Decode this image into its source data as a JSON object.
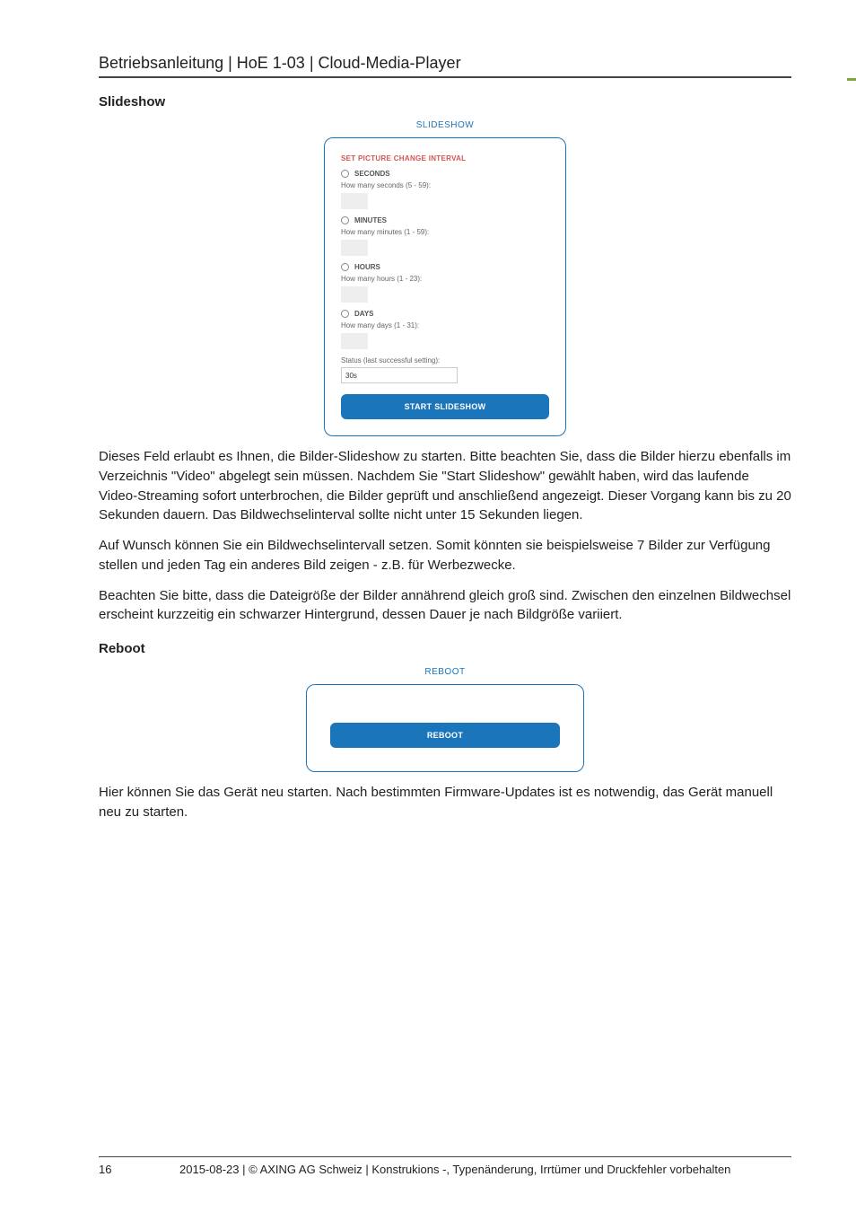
{
  "header": {
    "title": "Betriebsanleitung | HoE 1-03 | Cloud-Media-Player"
  },
  "sections": {
    "slideshow": {
      "heading": "Slideshow",
      "card": {
        "title": "SLIDESHOW",
        "groupTitle": "SET PICTURE CHANGE INTERVAL",
        "seconds": {
          "radio": "SECONDS",
          "hint": "How many seconds (5 - 59):"
        },
        "minutes": {
          "radio": "MINUTES",
          "hint": "How many minutes (1 - 59):"
        },
        "hours": {
          "radio": "HOURS",
          "hint": "How many hours (1 - 23):"
        },
        "days": {
          "radio": "DAYS",
          "hint": "How many days (1 - 31):"
        },
        "statusLabel": "Status (last successful setting):",
        "statusValue": "30s",
        "button": "START SLIDESHOW"
      },
      "paragraphs": [
        "Dieses Feld erlaubt es Ihnen, die Bilder-Slideshow zu starten. Bitte beachten Sie, dass die Bilder hierzu ebenfalls im Verzeichnis \"Video\" abgelegt sein müssen. Nachdem Sie \"Start Slideshow\" gewählt haben, wird das laufende Video-Streaming sofort unterbrochen, die Bilder geprüft und anschließend angezeigt. Dieser Vorgang kann bis zu 20 Sekunden dauern. Das Bildwechselinterval sollte nicht unter 15 Sekunden liegen.",
        "Auf Wunsch können Sie ein Bildwechselintervall setzen. Somit könnten sie beispielsweise 7 Bilder zur Verfügung stellen und jeden Tag ein anderes Bild zeigen - z.B. für Werbezwecke.",
        "Beachten Sie bitte, dass die Dateigröße der Bilder annährend gleich groß sind. Zwischen den einzelnen Bildwechsel erscheint kurzzeitig ein schwarzer Hintergrund, dessen Dauer je nach Bildgröße variiert."
      ]
    },
    "reboot": {
      "heading": "Reboot",
      "card": {
        "title": "REBOOT",
        "button": "REBOOT"
      },
      "paragraphs": [
        "Hier können Sie das Gerät neu starten. Nach bestimmten Firmware-Updates ist es notwendig, das Gerät manuell neu zu starten."
      ]
    }
  },
  "footer": {
    "page": "16",
    "text": "2015-08-23 | © AXING AG Schweiz | Konstrukions -, Typenänderung, Irrtümer und Druckfehler vorbehalten"
  }
}
